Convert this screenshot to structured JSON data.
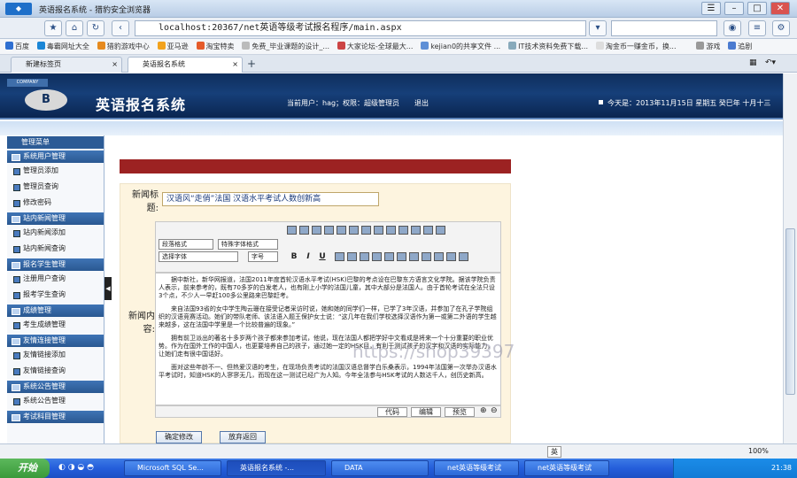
{
  "browser": {
    "title": "英语报名系统 - 猎豹安全浏览器",
    "url": "localhost:20367/net英语等级考试报名程序/main.aspx",
    "bookmarks": [
      "百度",
      "毒霸网址大全",
      "猎豹游戏中心",
      "亚马逊",
      "淘宝特卖",
      "免费_毕业课题的设计_...",
      "大家论坛-全球最大...",
      "kejian0的共享文件 ...",
      "IT技术资料免费下载...",
      "淘金币一赚金币，换...",
      "游戏",
      "追剧"
    ],
    "tabs": [
      {
        "label": "新建标签页"
      },
      {
        "label": "英语报名系统"
      }
    ]
  },
  "header": {
    "badge": "COMPANY",
    "emblem": "B",
    "system_name": "英语报名系统",
    "user_info": "当前用户：hag；权限：超级管理员",
    "logout": "退出",
    "date": "今天是：2013年11月15日 星期五 癸巳年 十月十三"
  },
  "sidebar": {
    "title": "管理菜单",
    "sections": [
      {
        "title": "系统用户管理",
        "items": [
          "管理员添加",
          "管理员查询",
          "修改密码"
        ]
      },
      {
        "title": "站内新闻管理",
        "items": [
          "站内新闻添加",
          "站内新闻查询"
        ]
      },
      {
        "title": "报名学生管理",
        "items": [
          "注册用户查询",
          "报考学生查询"
        ]
      },
      {
        "title": "成绩管理",
        "items": [
          "考生成绩管理"
        ]
      },
      {
        "title": "友情连接管理",
        "items": [
          "友情链接添加",
          "友情链接查询"
        ]
      },
      {
        "title": "系统公告管理",
        "items": [
          "系统公告管理"
        ]
      },
      {
        "title": "考试科目管理",
        "items": []
      }
    ]
  },
  "form": {
    "title_label": "新闻标题:",
    "title_value": "汉语风“走俏”法国 汉语水平考试人数创新高",
    "content_label": "新闻内容:",
    "toolbar": {
      "paragraph": "段落格式",
      "special": "特殊字体格式",
      "font": "选择字体",
      "size": "字号",
      "bold": "B",
      "italic": "I",
      "underline": "U"
    },
    "body": [
      "据中新社，新华网报道，法国2011年度首轮汉语水平考试(HSK)巴黎的考点设在巴黎东方语言文化学院。据该学院负责人表示，前来参考的，既有70多岁的白发老人，也有刚上小学的法国儿童，其中大部分是法国人。由于首轮考试在全法只设3个点，不少人一早赶100多公里路来巴黎赶考。",
      "来自法国93省的女中学生陶云珊在接受记者采访时说，她和她的同学们一样，已学了3年汉语，并参加了在孔子学院组织的汉语竞赛活动。她们的带队老师、该法语入题王保护女士说：“这几年在我们学校选择汉语作为第一或第二外语的学生越来越多，这在法国中学里是一个比较普遍的现象。”",
      "拥有前卫派出的著名十多岁两个孩子都来参加考试，他说，现在法国人都把学好中文看成是将来一个十分重要的职业优势。作为在国外工作的中国人，也更要培养自己的孩子，通过她一定的HSK目，有利于测试孩子的汉字和汉语的实际能力，让她们走有很中国话好。",
      "面对这些年龄不一、但热爱汉语的考生，在现场负责考试的法国汉语总督学白乐桑表示，1994年法国第一次举办汉语水平考试时，知道HSK的人寥寥无几，而现在这一测试已经广为人知。今年全法参与HSK考试的人数达千人，创历史新高。"
    ],
    "modes": [
      "代码",
      "编辑",
      "预览"
    ],
    "submit": "确定修改",
    "back": "放弃返回"
  },
  "watermark": "https://shop39397",
  "statusbar": {
    "ime": "英",
    "zoom": "100%"
  },
  "taskbar": {
    "start": "开始",
    "tasks": [
      "Microsoft SQL Se...",
      "英语报名系统 -...",
      "DATA",
      "net英语等级考试",
      "net英语等级考试"
    ],
    "clock": "21:38"
  }
}
